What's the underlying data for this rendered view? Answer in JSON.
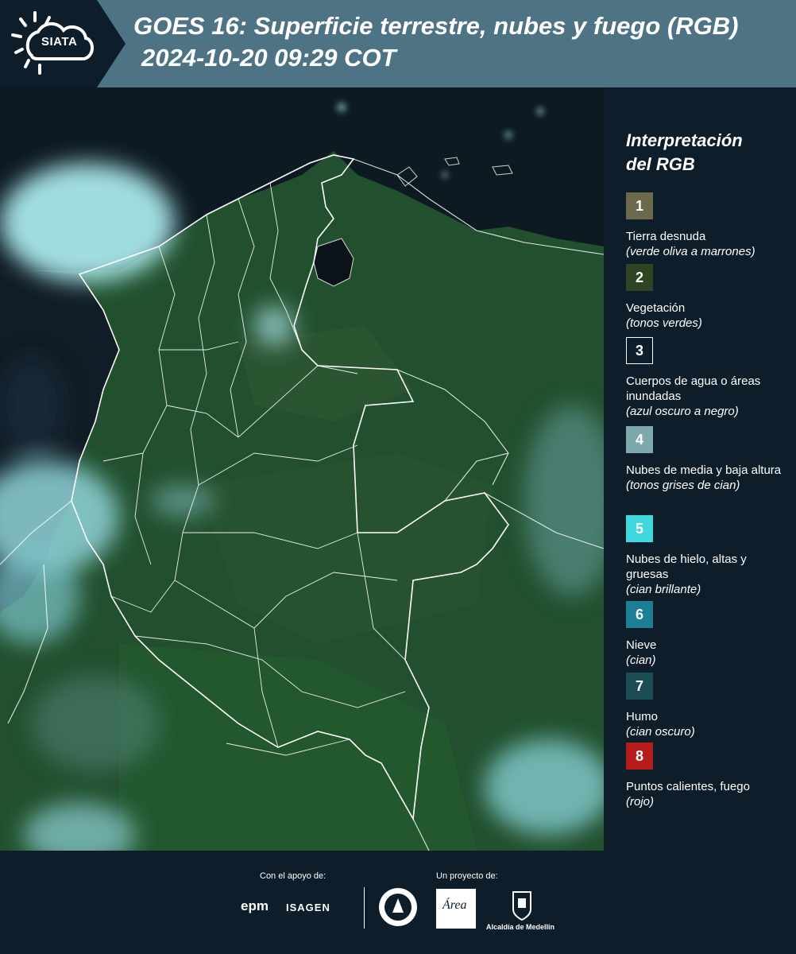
{
  "header": {
    "logo_text": "SIATA",
    "title": "GOES 16: Superficie terrestre, nubes y fuego (RGB)",
    "subtitle": "2024-10-20 09:29 COT"
  },
  "legend": {
    "title_line1": "Interpretación",
    "title_line2": "del RGB",
    "items": [
      {
        "num": "1",
        "label": "Tierra desnuda",
        "desc": "(verde oliva a marrones)",
        "color": "#6b6a4c"
      },
      {
        "num": "2",
        "label": "Vegetación",
        "desc": "(tonos verdes)",
        "color": "#2e4423"
      },
      {
        "num": "3",
        "label": "Cuerpos de agua o áreas inundadas",
        "desc": "(azul oscuro a negro)",
        "color": "#0d1e2a"
      },
      {
        "num": "4",
        "label": "Nubes de media y baja altura",
        "desc": "(tonos grises de cian)",
        "color": "#7fa8ab"
      },
      {
        "num": "5",
        "label": "Nubes de hielo, altas y gruesas",
        "desc": "(cian brillante)",
        "color": "#3fd8de"
      },
      {
        "num": "6",
        "label": "Nieve",
        "desc": "(cian)",
        "color": "#1c7f95"
      },
      {
        "num": "7",
        "label": "Humo",
        "desc": "(cian oscuro)",
        "color": "#1b4d55"
      },
      {
        "num": "8",
        "label": "Puntos calientes, fuego",
        "desc": "(rojo)",
        "color": "#b71c1c"
      }
    ]
  },
  "footer": {
    "support_label": "Con el apoyo de:",
    "project_label": "Un proyecto de:",
    "epm": "epm",
    "isagen": "ISAGEN",
    "area_word": "Área",
    "alcaldia": "Alcaldía de Medellín"
  },
  "colors": {
    "header_bg": "#4e7384",
    "dark_bg": "#0d1e2a",
    "vegetation": "#2a5a34",
    "ocean": "#0d1820",
    "cloud": "#8fdde0"
  }
}
